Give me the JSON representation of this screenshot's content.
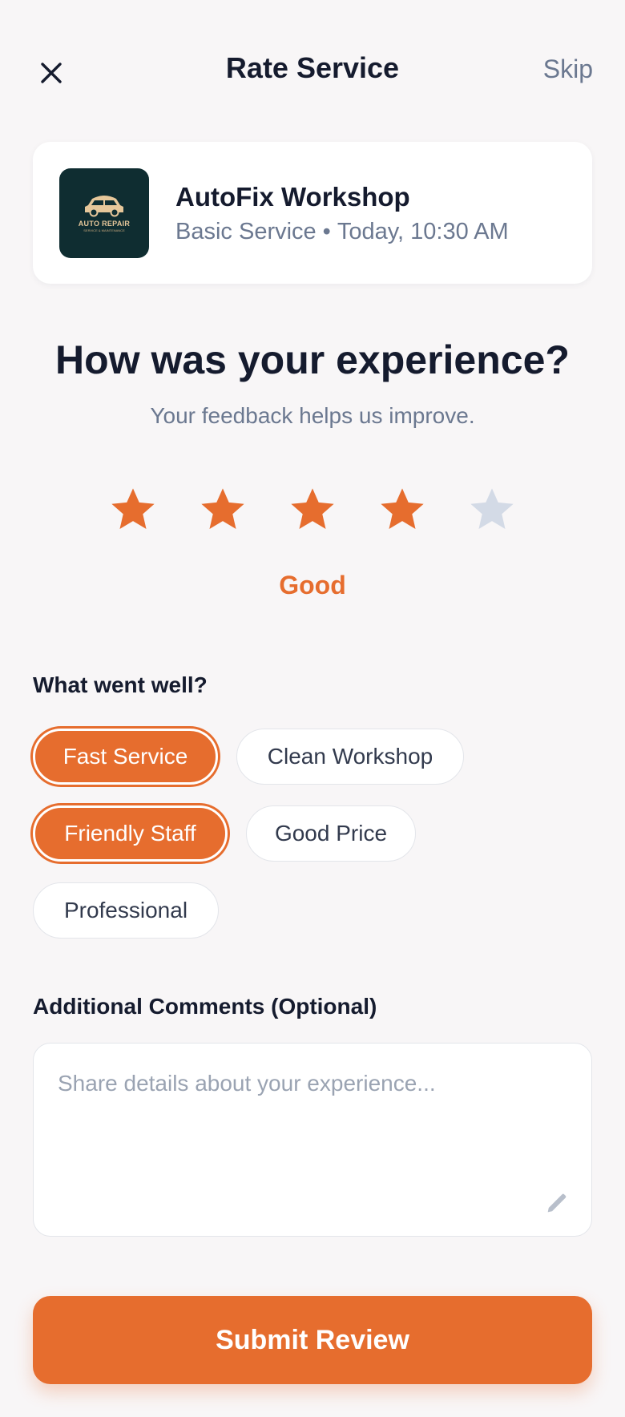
{
  "header": {
    "title": "Rate Service",
    "skip_label": "Skip",
    "close_icon": "close-icon"
  },
  "workshop": {
    "name": "AutoFix Workshop",
    "service": "Basic Service",
    "separator": "•",
    "time": "Today, 10:30 AM",
    "logo_text": "AUTO REPAIR",
    "logo_subtext": "SERVICE & MAINTENANCE"
  },
  "rating": {
    "question": "How was your experience?",
    "subtitle": "Your feedback helps us improve.",
    "value": 4,
    "max": 5,
    "label": "Good",
    "active_color": "#e66d2e",
    "inactive_color": "#d3dae6"
  },
  "highlights": {
    "title": "What went well?",
    "chips": [
      {
        "label": "Fast Service",
        "selected": true
      },
      {
        "label": "Clean Workshop",
        "selected": false
      },
      {
        "label": "Friendly Staff",
        "selected": true
      },
      {
        "label": "Good Price",
        "selected": false
      },
      {
        "label": "Professional",
        "selected": false
      }
    ]
  },
  "comments": {
    "title": "Additional Comments (Optional)",
    "placeholder": "Share details about your experience...",
    "value": "",
    "icon": "pencil-icon"
  },
  "submit": {
    "label": "Submit Review"
  },
  "colors": {
    "accent": "#e66d2e",
    "background": "#f8f6f7",
    "text": "#151b2e",
    "muted": "#6b7890"
  }
}
